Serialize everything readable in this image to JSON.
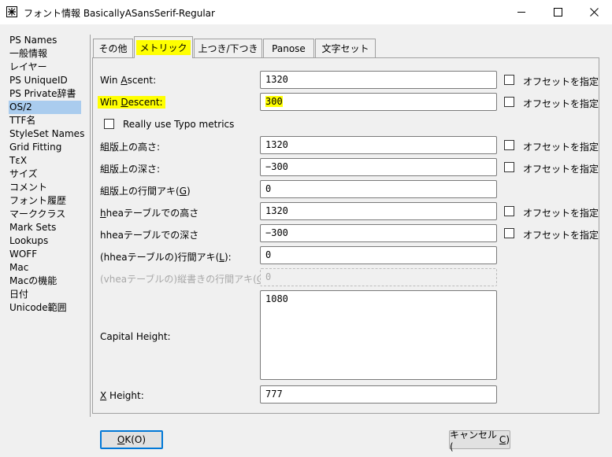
{
  "window": {
    "title": "フォント情報 BasicallyASansSerif-Regular"
  },
  "sidebar": {
    "items": [
      {
        "label": "PS Names"
      },
      {
        "label": "一般情報"
      },
      {
        "label": "レイヤー"
      },
      {
        "label": "PS UniqueID"
      },
      {
        "label": "PS Private辞書"
      },
      {
        "label": "OS/2",
        "selected": true
      },
      {
        "label": "TTF名"
      },
      {
        "label": "StyleSet Names"
      },
      {
        "label": "Grid Fitting"
      },
      {
        "label": "TεX"
      },
      {
        "label": "サイズ"
      },
      {
        "label": "コメント"
      },
      {
        "label": "フォント履歴"
      },
      {
        "label": "マーククラス"
      },
      {
        "label": "Mark Sets"
      },
      {
        "label": "Lookups"
      },
      {
        "label": "WOFF"
      },
      {
        "label": "Mac"
      },
      {
        "label": "Macの機能"
      },
      {
        "label": "日付"
      },
      {
        "label": "Unicode範囲"
      }
    ]
  },
  "tabs": [
    {
      "label": "その他"
    },
    {
      "label": "メトリック",
      "active": true
    },
    {
      "label": "上つき/下つき"
    },
    {
      "label": "Panose"
    },
    {
      "label": "文字セット"
    }
  ],
  "metrics": {
    "win_ascent": {
      "pre": "Win ",
      "key": "A",
      "post": "scent:",
      "value": "1320",
      "offset_label": "オフセットを指定"
    },
    "win_descent": {
      "pre": "Win ",
      "key": "D",
      "post": "escent:",
      "value": "300",
      "offset_label": "オフセットを指定"
    },
    "typo_checkbox": {
      "label": "Really use Typo metrics"
    },
    "typo_ascent": {
      "label": "組版上の高さ:",
      "value": "1320",
      "offset_label": "オフセットを指定"
    },
    "typo_descent": {
      "label": "組版上の深さ:",
      "value": "−300",
      "offset_label": "オフセットを指定"
    },
    "typo_linegap": {
      "pre": "組版上の行間アキ(",
      "key": "G",
      "post": ")",
      "value": "0"
    },
    "hhea_ascent": {
      "key": "h",
      "post": "heaテーブルでの高さ",
      "value": "1320",
      "offset_label": "オフセットを指定"
    },
    "hhea_descent": {
      "label": "hheaテーブルでの深さ",
      "value": "−300",
      "offset_label": "オフセットを指定"
    },
    "hhea_linegap": {
      "pre": "(hheaテーブルの)行間アキ(",
      "key": "L",
      "post": "):",
      "value": "0"
    },
    "vhea_linegap": {
      "pre": "(vheaテーブルの)縦書きの行間アキ(",
      "key": "C",
      "post": "):",
      "value": "0"
    },
    "capital_height": {
      "label": "Capital Height:",
      "value": "1080"
    },
    "x_height": {
      "key": "X",
      "post": " Height:",
      "value": "777"
    }
  },
  "buttons": {
    "ok": {
      "key": "O",
      "pre": "",
      "post": "K(O)"
    },
    "cancel": {
      "pre": "キャンセル(",
      "key": "C",
      "post": ")"
    }
  }
}
